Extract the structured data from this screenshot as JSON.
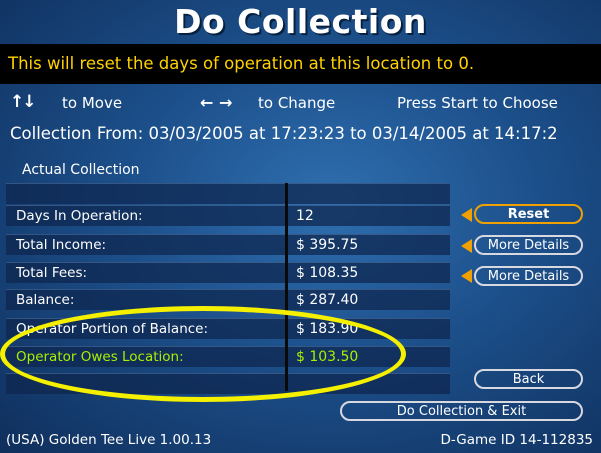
{
  "header": {
    "title": "Do Collection"
  },
  "warning": "This will reset the days of operation at this location to 0.",
  "help": {
    "move_label": "to Move",
    "change_label": "to Change",
    "start_label": "Press Start to Choose"
  },
  "collection_from": "Collection From: 03/03/2005 at 17:23:23 to 03/14/2005 at 14:17:2",
  "section_label": "Actual Collection",
  "rows": [
    {
      "label": "Days In Operation:",
      "value": "12"
    },
    {
      "label": "Total Income:",
      "value": "$ 395.75"
    },
    {
      "label": "Total Fees:",
      "value": "$ 108.35"
    },
    {
      "label": "Balance:",
      "value": "$ 287.40"
    },
    {
      "label": "Operator Portion of Balance:",
      "value": "$ 183.90"
    },
    {
      "label": "Operator Owes Location:",
      "value": "$ 103.50"
    }
  ],
  "buttons": {
    "reset": "Reset",
    "more_details_income": "More Details",
    "more_details_fees": "More Details",
    "back": "Back",
    "do_collection_exit": "Do Collection & Exit"
  },
  "footer": {
    "version": "(USA) Golden Tee Live 1.00.13",
    "game_id": "D-Game ID 14-112835"
  },
  "colors": {
    "warning_text": "#ffd200",
    "highlight_text": "#a8f000",
    "highlight_oval": "#f5f000",
    "reset_border": "#f0a000"
  }
}
